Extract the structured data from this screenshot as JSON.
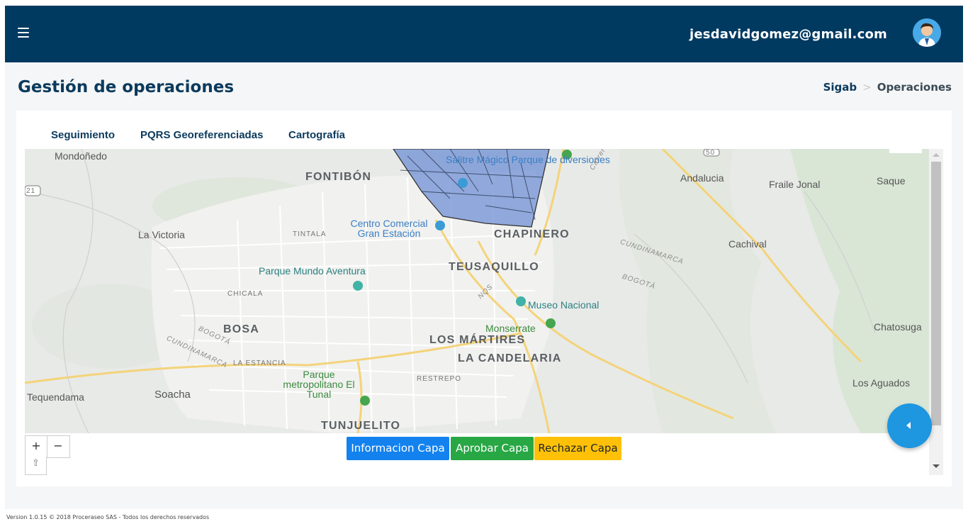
{
  "header": {
    "user_email": "jesdavidgomez@gmail.com"
  },
  "page": {
    "title": "Gestión de operaciones",
    "breadcrumb": [
      "Sigab",
      "Operaciones"
    ]
  },
  "tabs": [
    {
      "label": "Seguimiento"
    },
    {
      "label": "PQRS Georeferenciadas"
    },
    {
      "label": "Cartografía"
    }
  ],
  "map": {
    "districts": [
      "FONTIBÓN",
      "CHAPINERO",
      "TEUSAQUILLO",
      "BOSA",
      "LOS MÁRTIRES",
      "LA CANDELARIA",
      "TUNJUELITO"
    ],
    "places": [
      "Mondoñedo",
      "La Victoria",
      "Andalucia",
      "Fraile Jonal",
      "Saque",
      "Cachival",
      "Chatosuga",
      "Los Aguados",
      "Tequendama",
      "Soacha"
    ],
    "pois": [
      "Salitre Mágico Parque de diversiones",
      "Centro Comercial Gran Estación",
      "Parque Mundo Aventura",
      "Museo Nacional",
      "Monserrate",
      "Parque metropolitano El Tunal"
    ],
    "areas": [
      "TINTALA",
      "CHICALA",
      "LA ESTANCIA",
      "RESTREPO"
    ],
    "road_labels": [
      "CUNDINAMARCA",
      "BOGOTÁ",
      "NQS",
      "Carrera"
    ],
    "route_shields": [
      "21",
      "50"
    ],
    "polygon_color": "#6f8fd4"
  },
  "map_controls": {
    "zoom_in": "+",
    "zoom_out": "−",
    "rotate": "⇧"
  },
  "actions": {
    "info_label": "Informacion Capa",
    "approve_label": "Aprobar Capa",
    "reject_label": "Rechazar Capa"
  },
  "colors": {
    "header_bg": "#003a61",
    "title": "#0b3a5c",
    "info": "#1382ef",
    "approve": "#28a745",
    "reject": "#ffc107",
    "fab": "#1e96e0"
  },
  "footer": {
    "text": "Version 1.0.15 © 2018 Proceraseo SAS - Todos los derechos reservados"
  }
}
